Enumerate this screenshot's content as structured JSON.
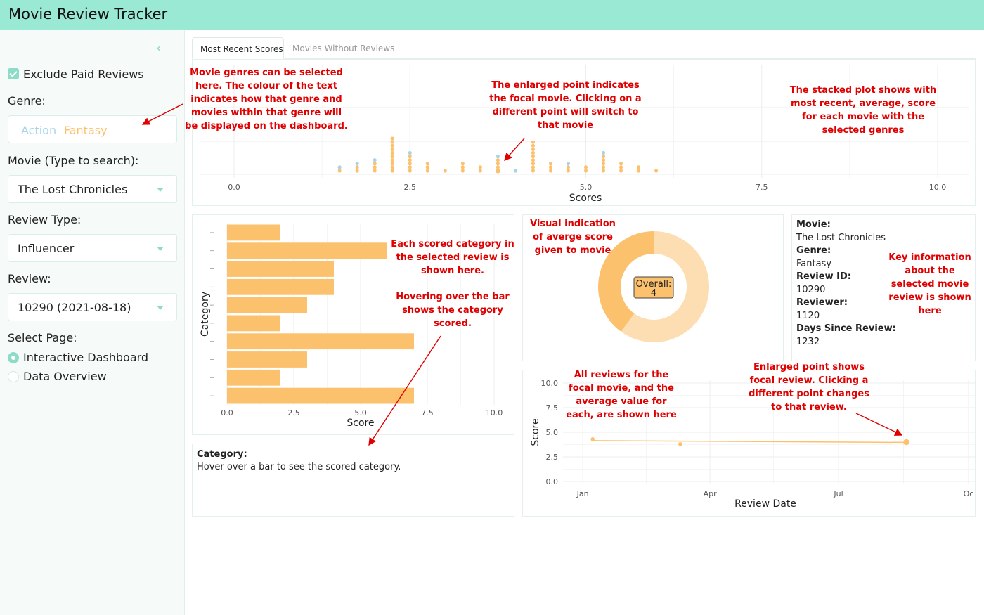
{
  "app": {
    "title": "Movie Review Tracker"
  },
  "sidebar": {
    "exclude_paid_label": "Exclude Paid Reviews",
    "genre_label": "Genre:",
    "genres": [
      {
        "label": "Action",
        "color": "#a8d4ea"
      },
      {
        "label": "Fantasy",
        "color": "#fcc16d"
      }
    ],
    "movie_label": "Movie (Type to search):",
    "movie_value": "The Lost Chronicles",
    "review_type_label": "Review Type:",
    "review_type_value": "Influencer",
    "review_label": "Review:",
    "review_value": "10290 (2021-08-18)",
    "page_label": "Select Page:",
    "pages": [
      {
        "label": "Interactive Dashboard",
        "selected": true
      },
      {
        "label": "Data Overview",
        "selected": false
      }
    ]
  },
  "tabs": [
    {
      "label": "Most Recent Scores",
      "active": true
    },
    {
      "label": "Movies Without Reviews",
      "active": false
    }
  ],
  "colors": {
    "accent": "#8edcc8",
    "fantasy": "#fcc16d",
    "action": "#a8d4ea",
    "donut_light": "#fddeb3",
    "annotation": "#e00000"
  },
  "chart_data": [
    {
      "type": "scatter",
      "xlabel": "Scores",
      "xlim": [
        0,
        10.5
      ],
      "xticks": [
        "0.0",
        "2.5",
        "5.0",
        "7.5",
        "10.0"
      ],
      "stacks": [
        {
          "x": 1.5,
          "fantasy": 1,
          "action": 1
        },
        {
          "x": 1.75,
          "fantasy": 2,
          "action": 1
        },
        {
          "x": 2.0,
          "fantasy": 3,
          "action": 1
        },
        {
          "x": 2.25,
          "fantasy": 10,
          "action": 0
        },
        {
          "x": 2.5,
          "fantasy": 5,
          "action": 1
        },
        {
          "x": 2.75,
          "fantasy": 3,
          "action": 0
        },
        {
          "x": 3.0,
          "fantasy": 1,
          "action": 0
        },
        {
          "x": 3.25,
          "fantasy": 3,
          "action": 0
        },
        {
          "x": 3.5,
          "fantasy": 2,
          "action": 0
        },
        {
          "x": 3.75,
          "fantasy": 4,
          "action": 1,
          "focal": true
        },
        {
          "x": 4.0,
          "fantasy": 0,
          "action": 1
        },
        {
          "x": 4.25,
          "fantasy": 9,
          "action": 0
        },
        {
          "x": 4.5,
          "fantasy": 3,
          "action": 0
        },
        {
          "x": 4.75,
          "fantasy": 2,
          "action": 1
        },
        {
          "x": 5.0,
          "fantasy": 2,
          "action": 0
        },
        {
          "x": 5.25,
          "fantasy": 5,
          "action": 1
        },
        {
          "x": 5.5,
          "fantasy": 3,
          "action": 0
        },
        {
          "x": 5.75,
          "fantasy": 2,
          "action": 0
        },
        {
          "x": 6.0,
          "fantasy": 1,
          "action": 0
        }
      ]
    },
    {
      "type": "bar",
      "orientation": "horizontal",
      "xlabel": "Score",
      "ylabel": "Category",
      "xlim": [
        0,
        10.5
      ],
      "xticks": [
        "0.0",
        "2.5",
        "5.0",
        "7.5",
        "10.0"
      ],
      "values": [
        2,
        6,
        4,
        4,
        3,
        2,
        7,
        3,
        2,
        7
      ]
    },
    {
      "type": "pie",
      "label": "Overall:",
      "value": "4",
      "overall": 4,
      "max": 10
    },
    {
      "type": "line",
      "xlabel": "Review Date",
      "ylabel": "Score",
      "ylim": [
        0,
        10
      ],
      "yticks": [
        "0.0",
        "2.5",
        "5.0",
        "7.5",
        "10.0"
      ],
      "xticks": [
        "Jan",
        "Apr",
        "Jul",
        "Oc"
      ],
      "points": [
        {
          "date": "2021-01-08",
          "score": 4.3
        },
        {
          "date": "2021-03-11",
          "score": 3.8
        },
        {
          "date": "2021-08-18",
          "score": 4.0,
          "focal": true
        }
      ],
      "average": [
        {
          "date": "2021-01-08",
          "score": 4.15
        },
        {
          "date": "2021-08-18",
          "score": 3.97
        }
      ]
    }
  ],
  "category_panel": {
    "title": "Category:",
    "hint": "Hover over a bar to see the scored category."
  },
  "info": {
    "movie_label": "Movie:",
    "movie": "The Lost Chronicles",
    "genre_label": "Genre:",
    "genre": "Fantasy",
    "review_id_label": "Review ID:",
    "review_id": "10290",
    "reviewer_label": "Reviewer:",
    "reviewer": "1120",
    "days_label": "Days Since Review:",
    "days": "1232"
  },
  "annotations": {
    "genre": "Movie genres can be selected here.  The colour of the text indicates how that genre and movies within that genre will be displayed on the dashboard.",
    "focal": "The enlarged point indicates the focal movie.  Clicking on a different point will switch to that movie",
    "stacked": "The stacked plot shows with most recent, average, score for each movie with the selected genres",
    "category": "Each scored category in the selected review is shown here.",
    "hover": "Hovering over the bar shows the category scored.",
    "donut": "Visual indication of averge score given to movie",
    "keyinfo": "Key information about the selected movie review is shown here",
    "reviews": "All reviews for the focal movie, and the average value for each, are shown here",
    "focal_review": "Enlarged point shows focal review.  Clicking a different point changes to that review."
  }
}
